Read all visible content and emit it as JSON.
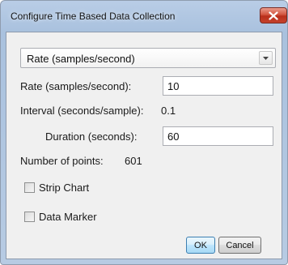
{
  "window": {
    "title": "Configure Time Based Data Collection"
  },
  "icons": {
    "close": "close-icon",
    "dropdown": "chevron-down-icon"
  },
  "mode_select": {
    "selected": "Rate (samples/second)"
  },
  "rate": {
    "label": "Rate (samples/second):",
    "value": "10"
  },
  "interval": {
    "label": "Interval (seconds/sample):",
    "value": "0.1"
  },
  "duration": {
    "label": "Duration (seconds):",
    "value": "60"
  },
  "points": {
    "label": "Number of points:",
    "value": "601"
  },
  "options": {
    "strip_chart": {
      "label": "Strip Chart",
      "checked": false
    },
    "data_marker": {
      "label": "Data Marker",
      "checked": false
    }
  },
  "buttons": {
    "ok": "OK",
    "cancel": "Cancel"
  },
  "colors": {
    "frame": "#b9cde6",
    "close_button": "#c4422c",
    "client_bg": "#f0f0f0",
    "default_button": "#bee6fd"
  }
}
